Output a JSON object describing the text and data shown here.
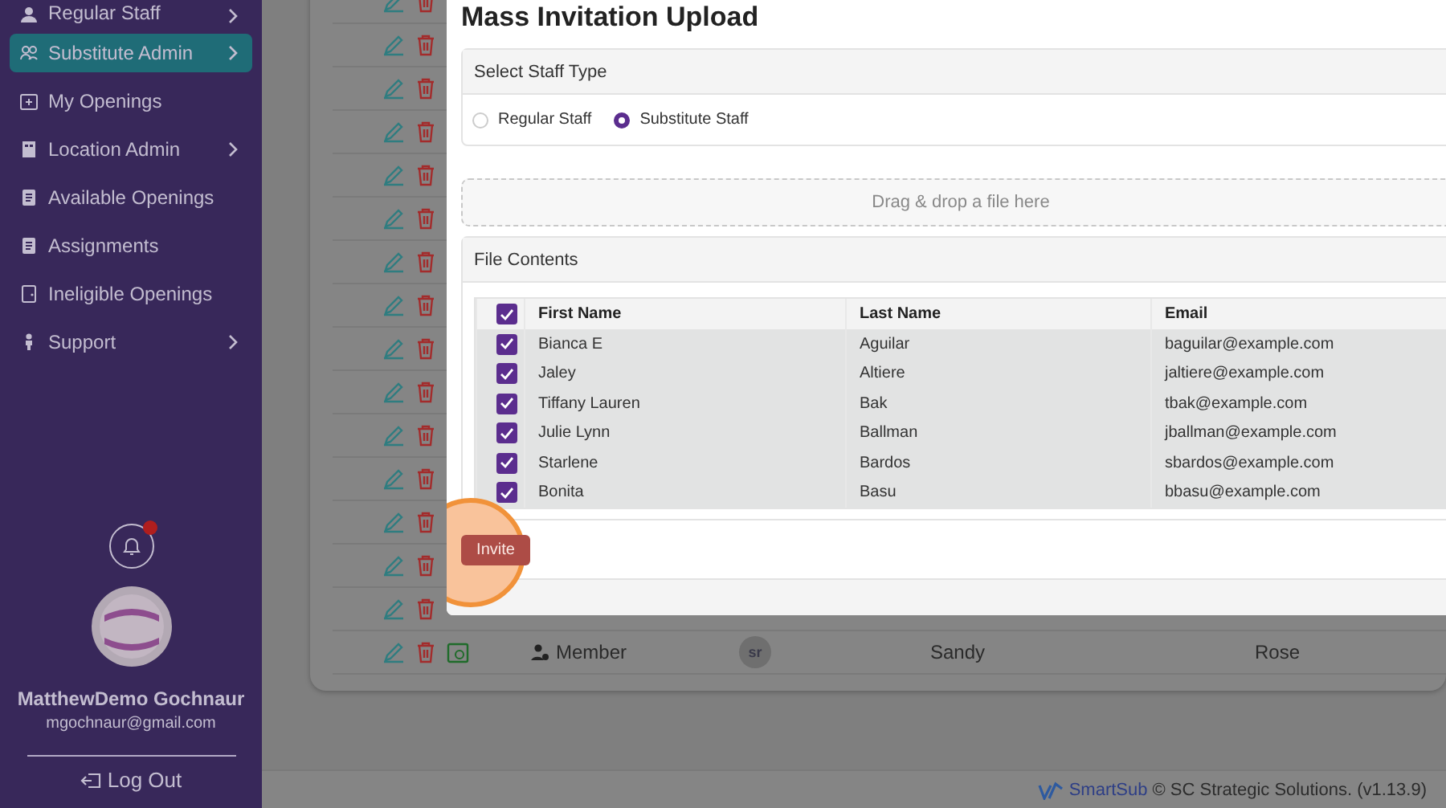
{
  "sidebar": {
    "items": [
      {
        "label": "Regular Staff",
        "has_submenu": true,
        "selected": false
      },
      {
        "label": "Substitute Admin",
        "has_submenu": true,
        "selected": true
      },
      {
        "label": "My Openings",
        "has_submenu": false,
        "selected": false
      },
      {
        "label": "Location Admin",
        "has_submenu": true,
        "selected": false
      },
      {
        "label": "Available Openings",
        "has_submenu": false,
        "selected": false
      },
      {
        "label": "Assignments",
        "has_submenu": false,
        "selected": false
      },
      {
        "label": "Ineligible Openings",
        "has_submenu": false,
        "selected": false
      },
      {
        "label": "Support",
        "has_submenu": true,
        "selected": false
      }
    ],
    "notifications": {
      "unread": true
    },
    "user": {
      "name": "MatthewDemo Gochnaur",
      "email": "mgochnaur@gmail.com"
    },
    "logout": "Log Out"
  },
  "background_table": {
    "rows": [
      {
        "role": "Member",
        "initials": "sr",
        "first_name": "Sandy",
        "last_name": "Rose"
      }
    ]
  },
  "modal": {
    "title": "Mass Invitation Upload",
    "staff_type": {
      "header": "Select Staff Type",
      "options": [
        {
          "label": "Regular Staff",
          "selected": false
        },
        {
          "label": "Substitute Staff",
          "selected": true
        }
      ]
    },
    "dropzone": "Drag & drop a file here",
    "file_contents": {
      "header": "File Contents",
      "all_checked": true,
      "columns": [
        "First Name",
        "Last Name",
        "Email"
      ],
      "rows": [
        {
          "checked": true,
          "cells": [
            "Bianca E",
            "Aguilar",
            "baguilar@example.com"
          ]
        },
        {
          "checked": true,
          "cells": [
            "Jaley",
            "Altiere",
            "jaltiere@example.com"
          ]
        },
        {
          "checked": true,
          "cells": [
            "Tiffany Lauren",
            "Bak",
            "tbak@example.com"
          ]
        },
        {
          "checked": true,
          "cells": [
            "Julie Lynn",
            "Ballman",
            "jballman@example.com"
          ]
        },
        {
          "checked": true,
          "cells": [
            "Starlene",
            "Bardos",
            "sbardos@example.com"
          ]
        },
        {
          "checked": true,
          "cells": [
            "Bonita",
            "Basu",
            "bbasu@example.com"
          ]
        }
      ]
    },
    "invite_button": "Invite",
    "highlighted": true
  },
  "footer": {
    "brand": "SmartSub",
    "text": "© SC Strategic Solutions. (v1.13.9)"
  }
}
